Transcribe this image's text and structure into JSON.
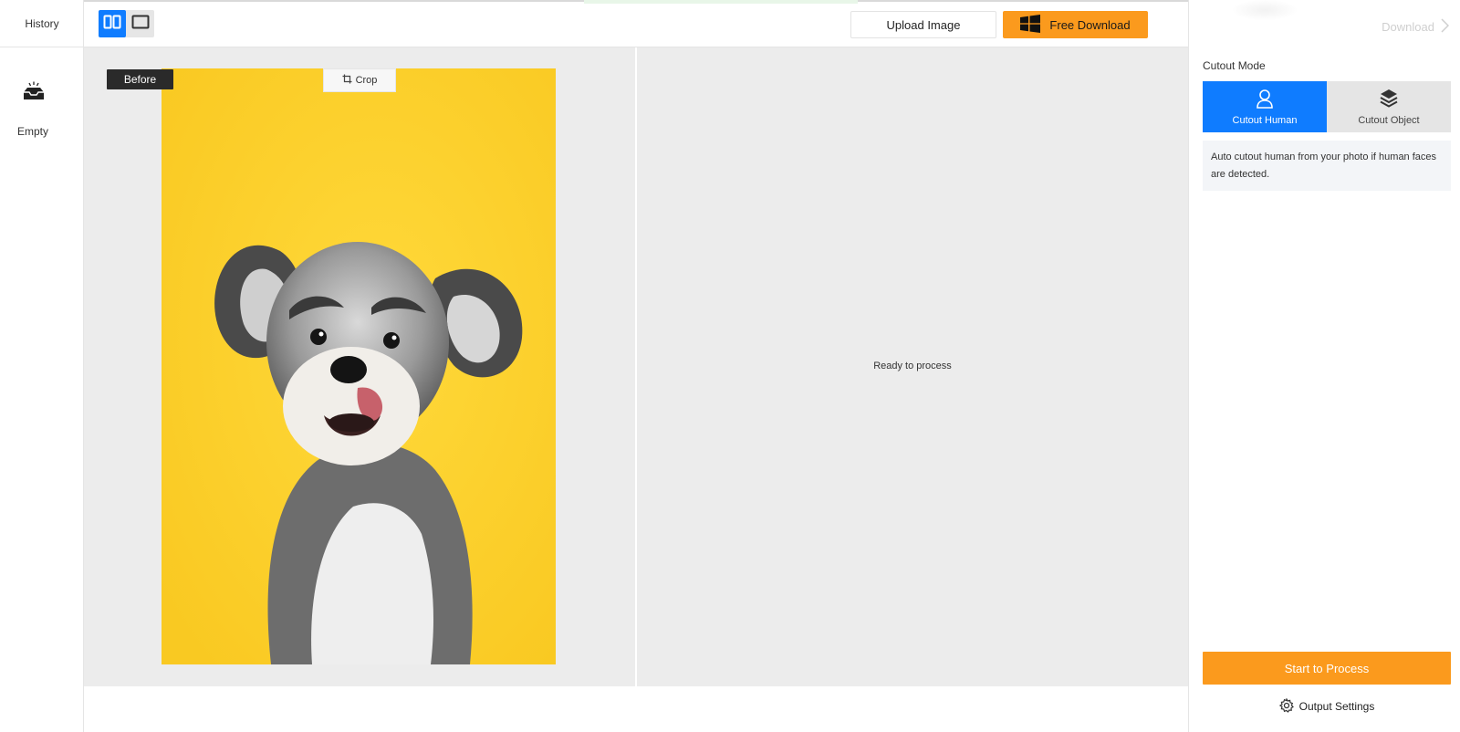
{
  "sidebar": {
    "title": "History",
    "empty_label": "Empty",
    "empty_icon": "empty-tray-icon"
  },
  "toolbar": {
    "view_modes": [
      {
        "name": "split-view",
        "icon": "split-view-icon",
        "active": true
      },
      {
        "name": "single-view",
        "icon": "single-view-icon",
        "active": false
      }
    ],
    "upload_label": "Upload Image",
    "free_download_label": "Free Download",
    "free_download_icon": "windows-logo-icon"
  },
  "canvas": {
    "before_label": "Before",
    "crop_label": "Crop",
    "crop_icon": "crop-icon",
    "status_text": "Ready to process",
    "photo_alt": "dog photo",
    "photo_background": "#fdd12c"
  },
  "right_panel": {
    "download_label": "Download",
    "mode_title": "Cutout Mode",
    "modes": [
      {
        "label": "Cutout Human",
        "icon": "person-icon",
        "active": true
      },
      {
        "label": "Cutout Object",
        "icon": "layers-icon",
        "active": false
      }
    ],
    "mode_description": "Auto cutout human from your photo if human faces are detected.",
    "process_label": "Start to Process",
    "output_settings_label": "Output Settings",
    "output_settings_icon": "gear-icon"
  },
  "colors": {
    "accent_blue": "#0f7cff",
    "accent_orange": "#fb9a1d",
    "canvas_bg": "#ececec"
  }
}
